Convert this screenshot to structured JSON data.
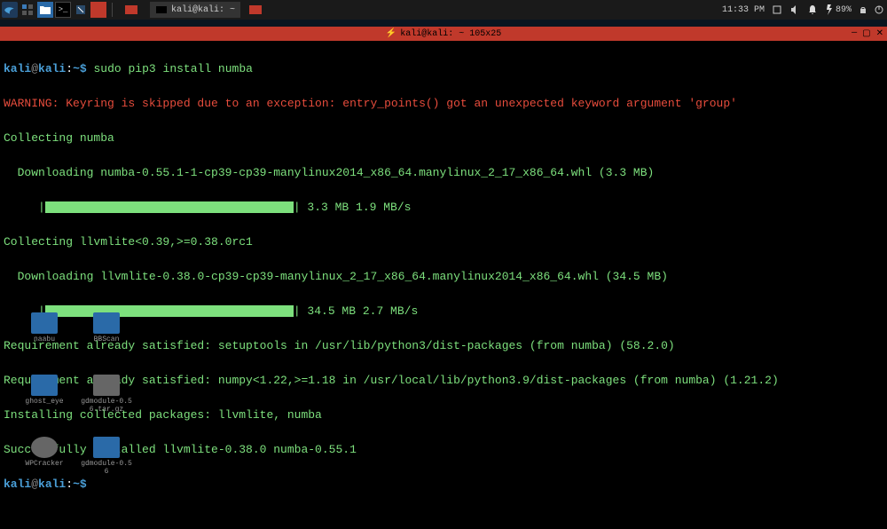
{
  "taskbar": {
    "time": "11:33 PM",
    "battery": "89%",
    "task1_label": "",
    "task2_label": "kali@kali: ~"
  },
  "terminal": {
    "title_icon": "⚡",
    "title": "kali@kali: ~ 105x25",
    "prompt": {
      "user": "kali",
      "at": "@",
      "host": "kali",
      "colon": ":",
      "path": "~",
      "dollar": "$"
    },
    "command": "sudo pip3 install numba",
    "lines": {
      "warn": "WARNING: Keyring is skipped due to an exception: entry_points() got an unexpected keyword argument 'group'",
      "collecting1": "Collecting numba",
      "download1": "  Downloading numba-0.55.1-1-cp39-cp39-manylinux2014_x86_64.manylinux_2_17_x86_64.whl (3.3 MB)",
      "progress1_left": "     |",
      "progress1_right": "| 3.3 MB 1.9 MB/s",
      "collecting2": "Collecting llvmlite<0.39,>=0.38.0rc1",
      "download2": "  Downloading llvmlite-0.38.0-cp39-cp39-manylinux_2_17_x86_64.manylinux2014_x86_64.whl (34.5 MB)",
      "progress2_left": "     |",
      "progress2_right": "| 34.5 MB 2.7 MB/s",
      "req1": "Requirement already satisfied: setuptools in /usr/lib/python3/dist-packages (from numba) (58.2.0)",
      "req2": "Requirement already satisfied: numpy<1.22,>=1.18 in /usr/local/lib/python3.9/dist-packages (from numba) (1.21.2)",
      "installing": "Installing collected packages: llvmlite, numba",
      "success": "Successfully installed llvmlite-0.38.0 numba-0.55.1"
    }
  },
  "desktop_icons": [
    {
      "label": "naabu"
    },
    {
      "label": "BBScan"
    },
    {
      "label": "ghost_eye"
    },
    {
      "label": "gdmodule-0.56.tar.gz"
    },
    {
      "label": "WPCracker"
    },
    {
      "label": "gdmodule-0.56"
    }
  ]
}
